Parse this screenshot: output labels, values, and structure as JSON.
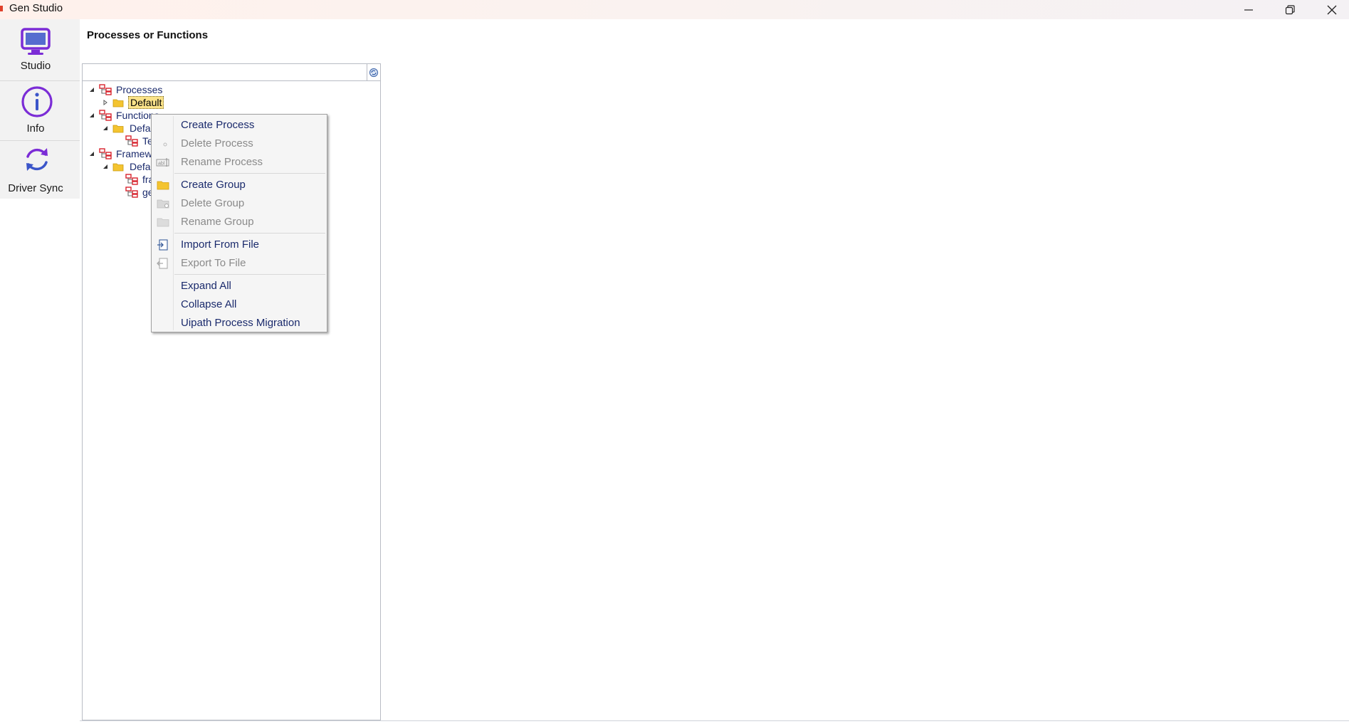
{
  "window": {
    "title": "Gen Studio",
    "controls": [
      "minimize-icon",
      "restore-icon",
      "close-icon"
    ]
  },
  "nav": {
    "items": [
      {
        "label": "Studio",
        "icon": "monitor-icon",
        "color": "#7b2cd6"
      },
      {
        "label": "Info",
        "icon": "info-icon",
        "color": "#7b2cd6"
      },
      {
        "label": "Driver Sync",
        "icon": "sync-icon",
        "color": "#3b55c9"
      }
    ]
  },
  "panel": {
    "title": "Processes or Functions",
    "search": {
      "value": "",
      "placeholder": "",
      "button_icon": "search-refresh-icon"
    }
  },
  "tree": {
    "nodes": [
      {
        "label": "Processes",
        "level": 0,
        "expanded": true,
        "icon": "hierarchy-icon"
      },
      {
        "label": "Default",
        "level": 1,
        "expanded": false,
        "icon": "folder-icon",
        "selected": true
      },
      {
        "label": "Functions",
        "level": 0,
        "expanded": true,
        "icon": "hierarchy-icon"
      },
      {
        "label": "Default",
        "level": 1,
        "expanded": true,
        "icon": "folder-icon"
      },
      {
        "label": "Te",
        "level": 2,
        "icon": "hierarchy-icon"
      },
      {
        "label": "Framework",
        "level": 0,
        "expanded": true,
        "icon": "hierarchy-icon"
      },
      {
        "label": "Default",
        "level": 1,
        "expanded": true,
        "icon": "folder-icon"
      },
      {
        "label": "fra",
        "level": 2,
        "icon": "hierarchy-icon"
      },
      {
        "label": "ge",
        "level": 2,
        "icon": "hierarchy-icon"
      }
    ]
  },
  "context_menu": {
    "items": [
      {
        "label": "Create Process",
        "enabled": true,
        "icon": ""
      },
      {
        "label": "Delete Process",
        "enabled": false,
        "icon": "delete-process-icon"
      },
      {
        "label": "Rename Process",
        "enabled": false,
        "icon": "rename-process-icon"
      },
      {
        "label": "Create Group",
        "enabled": true,
        "icon": "folder-icon"
      },
      {
        "label": "Delete Group",
        "enabled": false,
        "icon": "delete-folder-icon"
      },
      {
        "label": "Rename Group",
        "enabled": false,
        "icon": "rename-folder-icon"
      },
      {
        "label": "Import From File",
        "enabled": true,
        "icon": "import-icon"
      },
      {
        "label": "Export To File",
        "enabled": false,
        "icon": "export-icon"
      },
      {
        "label": "Expand All",
        "enabled": true,
        "icon": ""
      },
      {
        "label": "Collapse All",
        "enabled": true,
        "icon": ""
      },
      {
        "label": "Uipath Process Migration",
        "enabled": true,
        "icon": ""
      }
    ]
  },
  "colors": {
    "accent_purple": "#7b2cd6",
    "tree_text": "#1a2a6c",
    "selection": "#fbe38a",
    "folder": "#f4c430",
    "tree_icon_red": "#d9232d"
  }
}
